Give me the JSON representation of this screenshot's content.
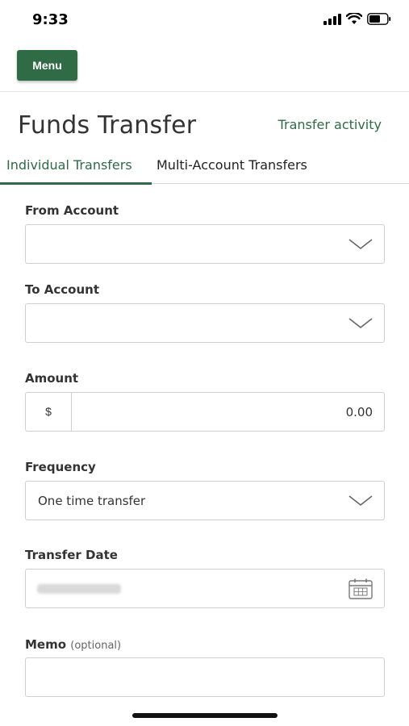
{
  "status": {
    "time": "9:33",
    "icons": [
      "cellular-signal-icon",
      "wifi-icon",
      "battery-icon"
    ]
  },
  "header": {
    "menu_label": "Menu"
  },
  "page": {
    "title": "Funds Transfer",
    "activity_link": "Transfer activity"
  },
  "tabs": [
    {
      "label": "Individual Transfers",
      "active": true
    },
    {
      "label": "Multi-Account Transfers",
      "active": false
    }
  ],
  "form": {
    "from_account": {
      "label": "From Account",
      "value": ""
    },
    "to_account": {
      "label": "To Account",
      "value": ""
    },
    "amount": {
      "label": "Amount",
      "currency": "$",
      "value": "0.00"
    },
    "frequency": {
      "label": "Frequency",
      "value": "One time transfer"
    },
    "transfer_date": {
      "label": "Transfer Date"
    },
    "memo": {
      "label": "Memo",
      "optional": "(optional)",
      "value": ""
    }
  },
  "colors": {
    "brand_green": "#2f6b45",
    "border": "#cfcfcf"
  }
}
